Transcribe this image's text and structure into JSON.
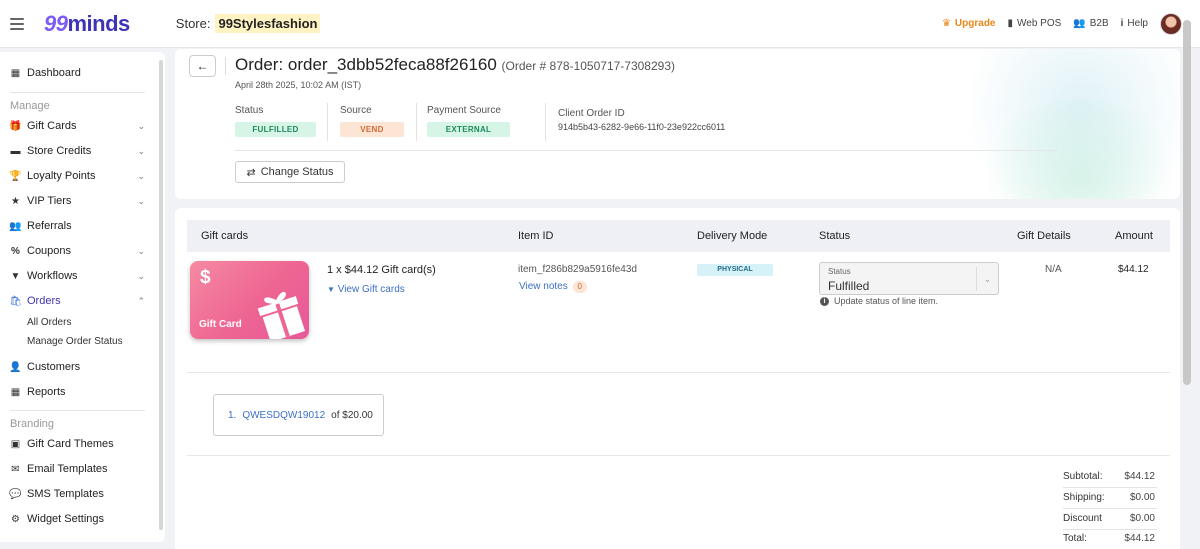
{
  "topbar": {
    "logo_nines": "99",
    "logo_text": "minds",
    "store_label": "Store:",
    "store_name": "99Stylesfashion",
    "upgrade": "Upgrade",
    "web_pos": "Web POS",
    "b2b": "B2B",
    "help": "Help"
  },
  "sidebar": {
    "dashboard": "Dashboard",
    "section_manage": "Manage",
    "gift_cards": "Gift Cards",
    "store_credits": "Store Credits",
    "loyalty_points": "Loyalty Points",
    "vip_tiers": "VIP Tiers",
    "referrals": "Referrals",
    "coupons": "Coupons",
    "workflows": "Workflows",
    "orders": "Orders",
    "all_orders": "All Orders",
    "manage_order_status": "Manage Order Status",
    "customers": "Customers",
    "reports": "Reports",
    "section_branding": "Branding",
    "gift_card_themes": "Gift Card Themes",
    "email_templates": "Email Templates",
    "sms_templates": "SMS Templates",
    "widget_settings": "Widget Settings"
  },
  "order": {
    "title": "Order: order_3dbb52feca88f26160",
    "order_number": "(Order # 878-1050717-7308293)",
    "date": "April 28th 2025, 10:02 AM (IST)",
    "status_label": "Status",
    "status_value": "FULFILLED",
    "source_label": "Source",
    "source_value": "VEND",
    "payment_label": "Payment Source",
    "payment_value": "EXTERNAL",
    "client_label": "Client Order ID",
    "client_value": "914b5b43-6282-9e66-11f0-23e922cc6011",
    "change_status": "Change Status"
  },
  "table": {
    "headers": {
      "gift_cards": "Gift cards",
      "item_id": "Item ID",
      "delivery_mode": "Delivery Mode",
      "status": "Status",
      "gift_details": "Gift Details",
      "amount": "Amount"
    },
    "row": {
      "card_symbol": "$",
      "card_label": "Gift Card",
      "description": "1 x $44.12 Gift card(s)",
      "view_gift_cards": "View Gift cards",
      "item_id": "item_f286b829a5916fe43d",
      "view_notes": "View notes",
      "notes_count": "0",
      "delivery_mode": "PHYSICAL",
      "status_select_label": "Status",
      "status_select_value": "Fulfilled",
      "status_hint": "Update status of line item.",
      "gift_details": "N/A",
      "amount": "$44.12"
    },
    "codes": [
      {
        "index": "1.",
        "code": "QWESDQW19012",
        "text": "of $20.00"
      }
    ]
  },
  "totals": {
    "subtotal_label": "Subtotal:",
    "subtotal_value": "$44.12",
    "shipping_label": "Shipping:",
    "shipping_value": "$0.00",
    "discount_label": "Discount",
    "discount_value": "$0.00",
    "total_label": "Total:",
    "total_value": "$44.12"
  }
}
